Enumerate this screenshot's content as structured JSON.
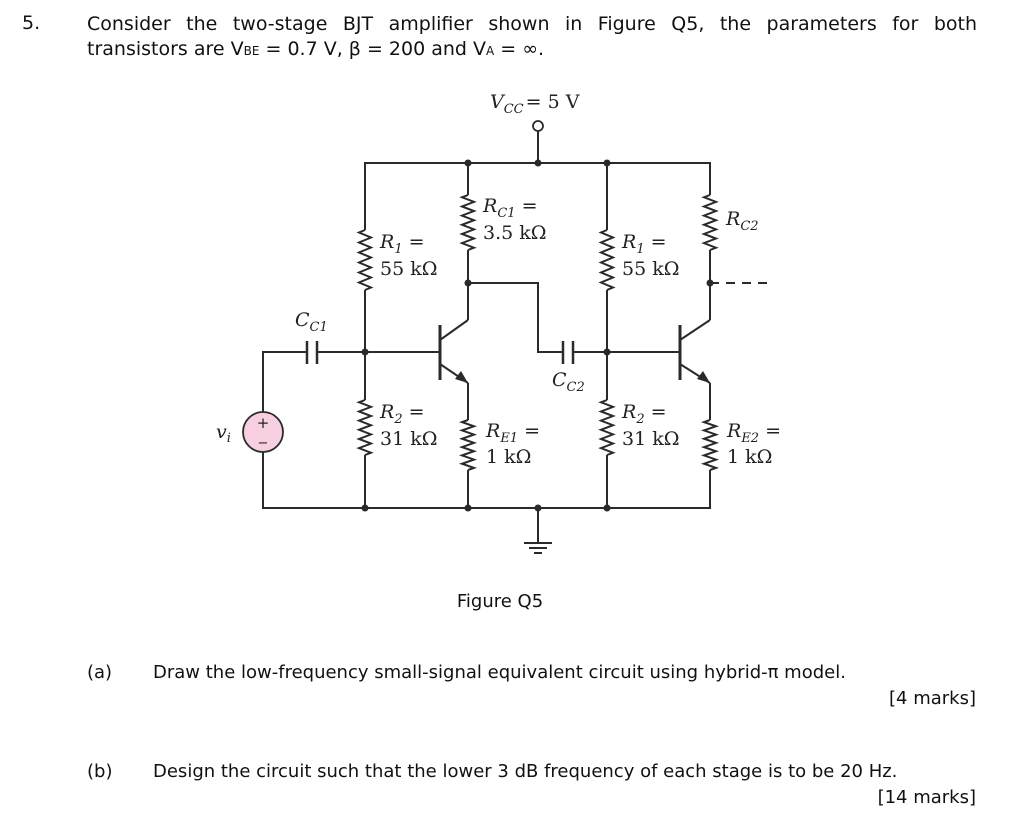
{
  "question": {
    "number": "5.",
    "line1": "Consider the two-stage BJT amplifier shown in Figure Q5, the parameters for both",
    "line2_prefix": "transistors are V",
    "vbe_sub": "BE",
    "line2_mid": " = 0.7 V, β = 200 and V",
    "va_sub": "A",
    "line2_suffix": " = ∞."
  },
  "circuit": {
    "supply_label": "V",
    "supply_sub": "CC",
    "supply_value": "= 5 V",
    "source_label": "v",
    "source_sub": "i",
    "source_plus": "+",
    "source_minus": "−",
    "source_fill": "#f6cfe0",
    "wire_color": "#2a2a2a",
    "cc1": {
      "name": "C",
      "sub": "C1"
    },
    "cc2": {
      "name": "C",
      "sub": "C2"
    },
    "r1_left": {
      "name": "R",
      "sub": "1",
      "eq": " =",
      "value": "55 kΩ"
    },
    "r2_left": {
      "name": "R",
      "sub": "2",
      "eq": " =",
      "value": "31 kΩ"
    },
    "rc1": {
      "name": "R",
      "sub": "C1",
      "eq": " =",
      "value": "3.5 kΩ"
    },
    "re1": {
      "name": "R",
      "sub": "E1",
      "eq": " =",
      "value": "1 kΩ"
    },
    "r1_right": {
      "name": "R",
      "sub": "1",
      "eq": " =",
      "value": "55 kΩ"
    },
    "r2_right": {
      "name": "R",
      "sub": "2",
      "eq": " =",
      "value": "31 kΩ"
    },
    "rc2": {
      "name": "R",
      "sub": "C2"
    },
    "re2": {
      "name": "R",
      "sub": "E2",
      "eq": " =",
      "value": "1 kΩ"
    }
  },
  "figure_caption": "Figure Q5",
  "parts": [
    {
      "label": "(a)",
      "text": "Draw the low-frequency small-signal equivalent circuit using hybrid-π model.",
      "marks": "[4 marks]"
    },
    {
      "label": "(b)",
      "text": "Design the circuit such that the lower 3 dB frequency of each stage is to be 20 Hz.",
      "marks": "[14 marks]"
    }
  ]
}
